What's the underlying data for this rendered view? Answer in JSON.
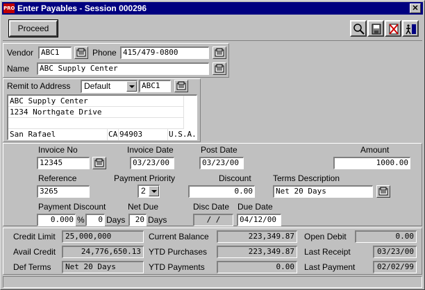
{
  "window": {
    "title": "Enter Payables - Session 000296",
    "app_icon_text": "PRO"
  },
  "toolbar": {
    "proceed_label": "Proceed",
    "icons": [
      "search-icon",
      "save-icon",
      "delete-icon",
      "exit-icon"
    ]
  },
  "vendor": {
    "vendor_label": "Vendor",
    "vendor_value": "ABC1",
    "phone_label": "Phone",
    "phone_value": "415/479-0800",
    "name_label": "Name",
    "name_value": "ABC Supply Center"
  },
  "remit": {
    "label": "Remit to Address",
    "selected": "Default",
    "code": "ABC1",
    "line1": "ABC Supply Center",
    "line2": "1234 Northgate Drive",
    "line3": "",
    "city": "San Rafael",
    "state": "CA",
    "zip": "94903",
    "country": "U.S.A."
  },
  "invoice": {
    "invoice_no_label": "Invoice No",
    "invoice_no": "12345",
    "invoice_date_label": "Invoice Date",
    "invoice_date": "03/23/00",
    "post_date_label": "Post Date",
    "post_date": "03/23/00",
    "amount_label": "Amount",
    "amount": "1000.00",
    "reference_label": "Reference",
    "reference": "3265",
    "payment_priority_label": "Payment Priority",
    "payment_priority": "2",
    "discount_label": "Discount",
    "discount": "0.00",
    "terms_label": "Terms Description",
    "terms": "Net 20 Days",
    "payment_discount_label": "Payment Discount",
    "payment_discount": "0.000",
    "percent_label": "%",
    "days_value": "0",
    "days_label": "Days",
    "net_due_label": "Net Due",
    "net_due": "20",
    "net_due_days_label": "Days",
    "disc_date_label": "Disc Date",
    "disc_date": "/  /",
    "due_date_label": "Due Date",
    "due_date": "04/12/00"
  },
  "summary": {
    "credit_limit_label": "Credit Limit",
    "credit_limit": "25,000,000",
    "avail_credit_label": "Avail Credit",
    "avail_credit": "24,776,650.13",
    "def_terms_label": "Def Terms",
    "def_terms": "Net 20 Days",
    "current_balance_label": "Current Balance",
    "current_balance": "223,349.87",
    "ytd_purchases_label": "YTD Purchases",
    "ytd_purchases": "223,349.87",
    "ytd_payments_label": "YTD Payments",
    "ytd_payments": "0.00",
    "open_debit_label": "Open Debit",
    "open_debit": "0.00",
    "last_receipt_label": "Last Receipt",
    "last_receipt": "03/23/00",
    "last_payment_label": "Last Payment",
    "last_payment": "02/02/99"
  }
}
